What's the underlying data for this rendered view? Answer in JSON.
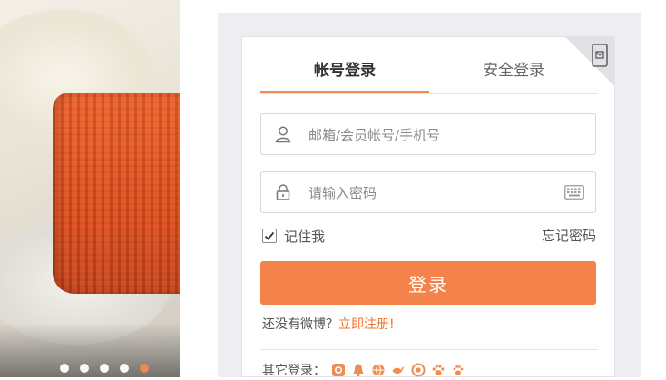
{
  "carousel": {
    "slide_count": 5,
    "active_index": 4,
    "colors": {
      "active": "#f08b52",
      "inactive": "#ffffff"
    }
  },
  "login": {
    "tabs": [
      {
        "label": "帐号登录",
        "active": true
      },
      {
        "label": "安全登录",
        "active": false
      }
    ],
    "username": {
      "placeholder": "邮箱/会员帐号/手机号",
      "value": "",
      "icon": "user-icon"
    },
    "password": {
      "placeholder": "请输入密码",
      "value": "",
      "icon": "lock-icon",
      "keyboard_icon": "keyboard-icon"
    },
    "remember": {
      "label": "记住我",
      "checked": true
    },
    "forgot_label": "忘记密码",
    "submit_label": "登录",
    "register": {
      "prompt": "还没有微博？",
      "link": "立即注册!"
    },
    "other_login": {
      "label": "其它登录：",
      "providers": [
        "qq-weibo-icon",
        "bell-icon",
        "globe-icon",
        "bird-icon",
        "circle-plus-icon",
        "paw-icon",
        "paw-icon"
      ]
    },
    "qr_corner_icon": "qr-phone-icon",
    "accent_color": "#f3834a"
  }
}
